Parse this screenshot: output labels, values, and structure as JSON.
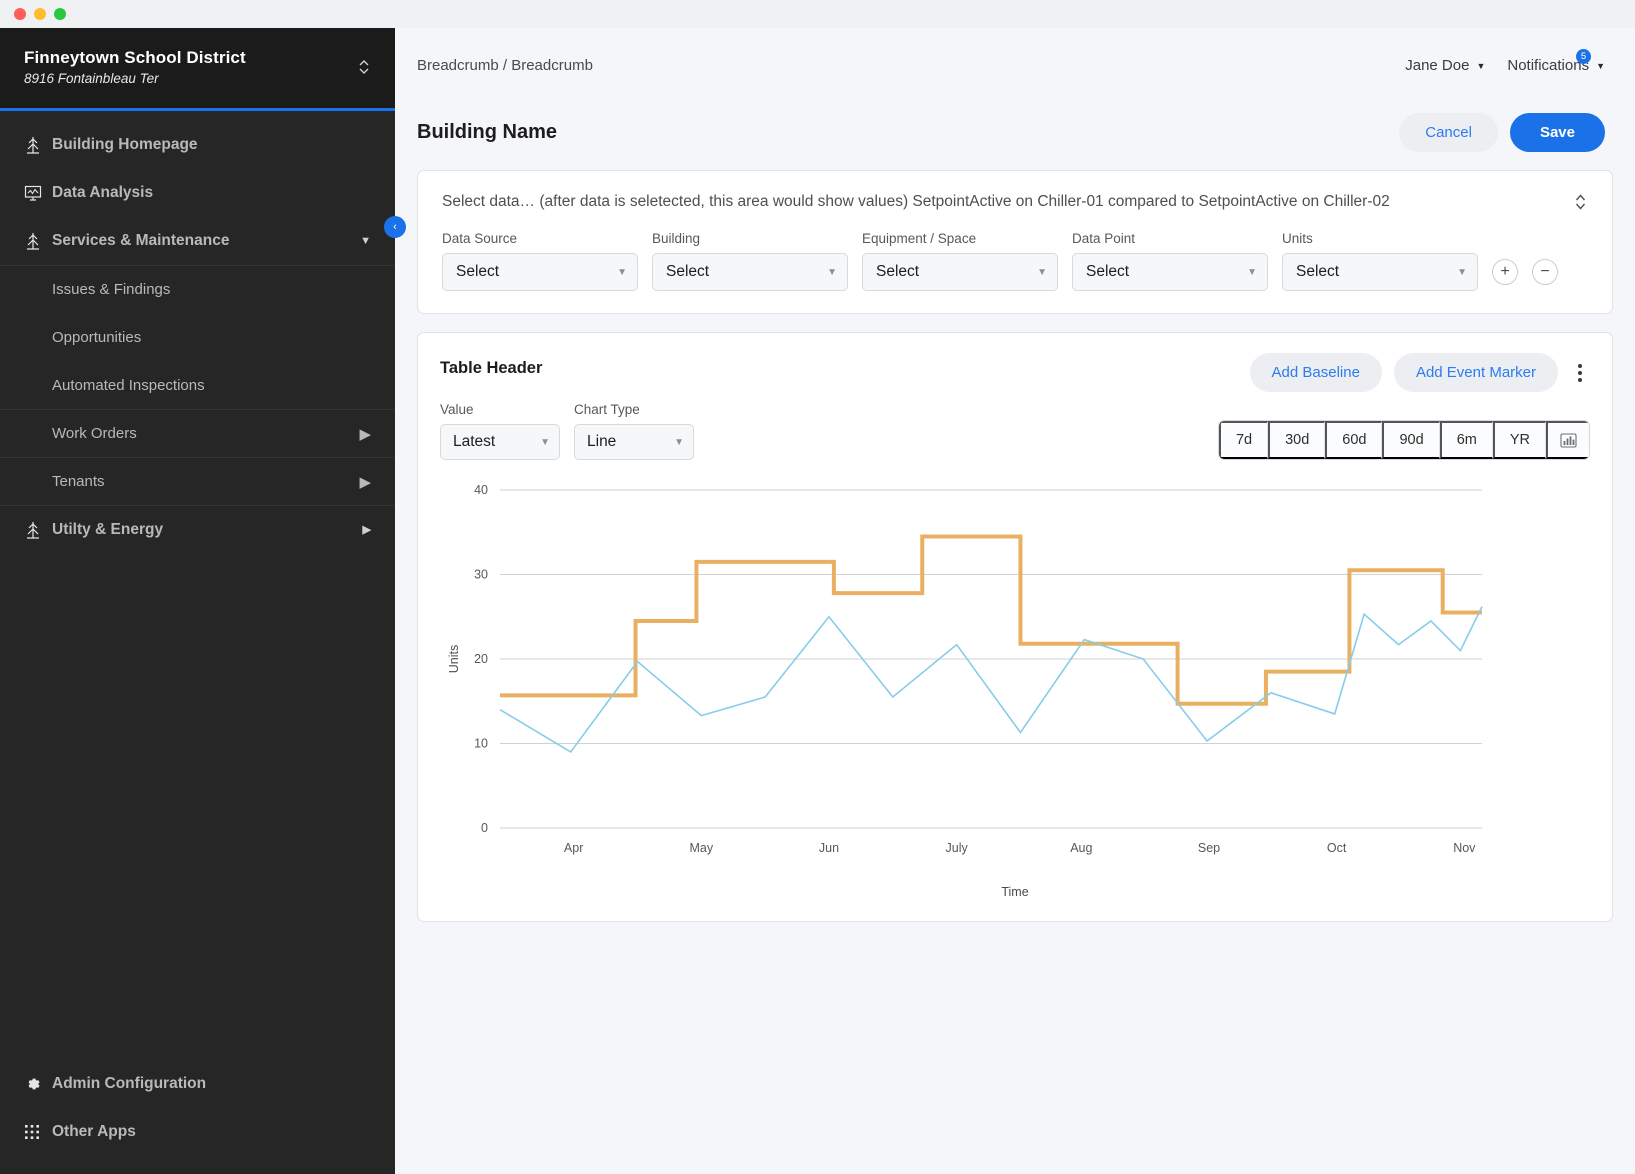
{
  "window": {
    "dots": [
      "red",
      "yellow",
      "green"
    ]
  },
  "sidebar": {
    "org_name": "Finneytown School District",
    "org_address": "8916 Fontainbleau Ter",
    "switch_icon": "updown-chevron-icon",
    "collapse_icon": "collapse-left-icon",
    "items": [
      {
        "label": "Building Homepage",
        "icon": "building-icon",
        "type": "main"
      },
      {
        "label": "Data Analysis",
        "icon": "chart-monitor-icon",
        "type": "main"
      },
      {
        "label": "Services & Maintenance",
        "icon": "building-icon",
        "type": "main",
        "caret": "chevron-down-icon",
        "expanded": true
      },
      {
        "label": "Issues & Findings",
        "type": "sub"
      },
      {
        "label": "Opportunities",
        "type": "sub"
      },
      {
        "label": "Automated Inspections",
        "type": "sub"
      },
      {
        "label": "Work Orders",
        "type": "sub",
        "caret": "chevron-right-icon"
      },
      {
        "label": "Tenants",
        "type": "sub",
        "caret": "chevron-right-icon"
      },
      {
        "label": "Utilty & Energy",
        "icon": "building-icon",
        "type": "main",
        "caret": "chevron-right-icon"
      }
    ],
    "bottom_items": [
      {
        "label": "Admin Configuration",
        "icon": "gear-icon"
      },
      {
        "label": "Other Apps",
        "icon": "grid-apps-icon"
      }
    ]
  },
  "topbar": {
    "breadcrumb": "Breadcrumb / Breadcrumb",
    "user": "Jane Doe",
    "notifications_label": "Notifications",
    "notifications_count": "5"
  },
  "page": {
    "title": "Building Name",
    "cancel_label": "Cancel",
    "save_label": "Save"
  },
  "selector": {
    "summary": "Select data… (after data is seletected, this area would show values) SetpointActive on Chiller-01 compared to SetpointActive on Chiller-02",
    "stepper_icon": "updown-chevron-icon",
    "fields": [
      {
        "label": "Data Source",
        "value": "Select"
      },
      {
        "label": "Building",
        "value": "Select"
      },
      {
        "label": "Equipment / Space",
        "value": "Select"
      },
      {
        "label": "Data Point",
        "value": "Select"
      },
      {
        "label": "Units",
        "value": "Select"
      }
    ],
    "add_label": "+",
    "remove_label": "−"
  },
  "chart_card": {
    "title": "Table Header",
    "add_baseline_label": "Add Baseline",
    "add_event_marker_label": "Add Event Marker",
    "kebab_icon": "more-vertical-icon",
    "value_label": "Value",
    "value_selected": "Latest",
    "chart_type_label": "Chart Type",
    "chart_type_selected": "Line",
    "ranges": [
      "7d",
      "30d",
      "60d",
      "90d",
      "6m",
      "YR"
    ],
    "range_icon": "bar-chart-icon"
  },
  "chart_data": {
    "type": "line",
    "title": "",
    "xlabel": "Time",
    "ylabel": "Units",
    "ylim": [
      0,
      40
    ],
    "yticks": [
      0,
      10,
      20,
      30,
      40
    ],
    "grid": true,
    "legend": "none",
    "xtick_labels": [
      "Apr",
      "May",
      "Jun",
      "July",
      "Aug",
      "Sep",
      "Oct",
      "Nov"
    ],
    "xtick_positions": [
      0.075,
      0.205,
      0.335,
      0.465,
      0.592,
      0.722,
      0.852,
      0.982
    ],
    "series": [
      {
        "name": "SetpointActive on Chiller-01",
        "color": "#e9b062",
        "style": "step",
        "width": 4,
        "points": [
          {
            "x": 0.0,
            "y": 15.7
          },
          {
            "x": 0.138,
            "y": 15.7
          },
          {
            "x": 0.138,
            "y": 24.5
          },
          {
            "x": 0.2,
            "y": 24.5
          },
          {
            "x": 0.2,
            "y": 31.5
          },
          {
            "x": 0.34,
            "y": 31.5
          },
          {
            "x": 0.34,
            "y": 27.8
          },
          {
            "x": 0.43,
            "y": 27.8
          },
          {
            "x": 0.43,
            "y": 34.5
          },
          {
            "x": 0.53,
            "y": 34.5
          },
          {
            "x": 0.53,
            "y": 21.8
          },
          {
            "x": 0.69,
            "y": 21.8
          },
          {
            "x": 0.69,
            "y": 14.7
          },
          {
            "x": 0.78,
            "y": 14.7
          },
          {
            "x": 0.78,
            "y": 18.5
          },
          {
            "x": 0.865,
            "y": 18.5
          },
          {
            "x": 0.865,
            "y": 30.5
          },
          {
            "x": 0.96,
            "y": 30.5
          },
          {
            "x": 0.96,
            "y": 25.5
          },
          {
            "x": 1.0,
            "y": 25.5
          }
        ]
      },
      {
        "name": "SetpointActive on Chiller-02",
        "color": "#86cdea",
        "style": "line",
        "width": 1.6,
        "points": [
          {
            "x": 0.0,
            "y": 14.0
          },
          {
            "x": 0.072,
            "y": 9.0
          },
          {
            "x": 0.14,
            "y": 19.7
          },
          {
            "x": 0.205,
            "y": 13.3
          },
          {
            "x": 0.27,
            "y": 15.5
          },
          {
            "x": 0.335,
            "y": 25.0
          },
          {
            "x": 0.4,
            "y": 15.5
          },
          {
            "x": 0.465,
            "y": 21.7
          },
          {
            "x": 0.53,
            "y": 11.3
          },
          {
            "x": 0.595,
            "y": 22.3
          },
          {
            "x": 0.655,
            "y": 20.0
          },
          {
            "x": 0.72,
            "y": 10.3
          },
          {
            "x": 0.785,
            "y": 16.0
          },
          {
            "x": 0.85,
            "y": 13.5
          },
          {
            "x": 0.88,
            "y": 25.3
          },
          {
            "x": 0.915,
            "y": 21.7
          },
          {
            "x": 0.948,
            "y": 24.5
          },
          {
            "x": 0.978,
            "y": 21.0
          },
          {
            "x": 1.0,
            "y": 26.2
          }
        ]
      }
    ]
  }
}
